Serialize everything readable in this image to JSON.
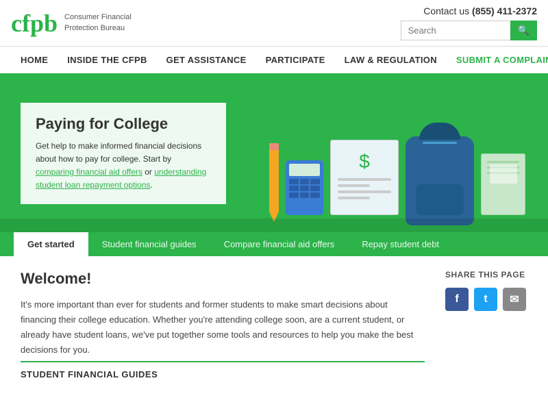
{
  "header": {
    "logo_text": "cfpb",
    "agency_line1": "Consumer Financial",
    "agency_line2": "Protection Bureau",
    "contact_label": "Contact us",
    "contact_phone": "(855) 411-2372",
    "search_placeholder": "Search",
    "search_button_label": "🔍"
  },
  "nav": {
    "items": [
      {
        "label": "HOME",
        "id": "home"
      },
      {
        "label": "INSIDE THE CFPB",
        "id": "inside"
      },
      {
        "label": "GET ASSISTANCE",
        "id": "assistance"
      },
      {
        "label": "PARTICIPATE",
        "id": "participate"
      },
      {
        "label": "LAW & REGULATION",
        "id": "law"
      }
    ],
    "complaint_label": "SUBMIT A COMPLAINT"
  },
  "hero": {
    "title": "Paying for College",
    "description": "Get help to make informed financial decisions about how to pay for college. Start by comparing financial aid offers or understanding student loan repayment options.",
    "link1": "comparing financial aid offers",
    "link2": "understanding student loan repayment options"
  },
  "tabs": [
    {
      "label": "Get started",
      "active": true
    },
    {
      "label": "Student financial guides",
      "active": false
    },
    {
      "label": "Compare financial aid offers",
      "active": false
    },
    {
      "label": "Repay student debt",
      "active": false
    }
  ],
  "welcome": {
    "title": "Welcome!",
    "text": "It's more important than ever for students and former students to make smart decisions about financing their college education. Whether you're attending college soon, are a current student, or already have student loans, we've put together some tools and resources to help you make the best decisions for you."
  },
  "share": {
    "title": "SHARE THIS PAGE",
    "icons": [
      {
        "id": "facebook",
        "label": "f"
      },
      {
        "id": "twitter",
        "label": "t"
      },
      {
        "id": "email",
        "label": "✉"
      }
    ]
  },
  "student_guides": {
    "section_title": "STUDENT FINANCIAL GUIDES"
  }
}
